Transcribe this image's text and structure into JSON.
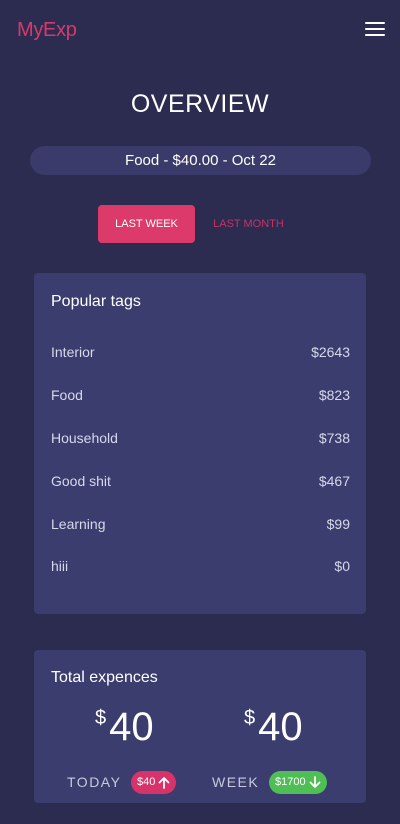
{
  "app": {
    "brand": "MyExp"
  },
  "page": {
    "title": "OVERVIEW",
    "latest_expense": "Food - $40.00 - Oct 22"
  },
  "period_toggle": {
    "active": "LAST WEEK",
    "inactive": "LAST MONTH"
  },
  "popular_tags": {
    "title": "Popular tags",
    "items": [
      {
        "name": "Interior",
        "amount": "$2643"
      },
      {
        "name": "Food",
        "amount": "$823"
      },
      {
        "name": "Household",
        "amount": "$738"
      },
      {
        "name": "Good shit",
        "amount": "$467"
      },
      {
        "name": "Learning",
        "amount": "$99"
      },
      {
        "name": "hiii",
        "amount": "$0"
      }
    ]
  },
  "total": {
    "title": "Total expences",
    "currency": "$",
    "today": {
      "value": "40",
      "label": "TODAY",
      "badge": "$40",
      "trend": "up"
    },
    "week": {
      "value": "40",
      "label": "WEEK",
      "badge": "$1700",
      "trend": "down"
    }
  },
  "colors": {
    "background": "#2c2b50",
    "card": "#3a3d6e",
    "accent": "#dd3a6c",
    "positive": "#4fbe55"
  }
}
